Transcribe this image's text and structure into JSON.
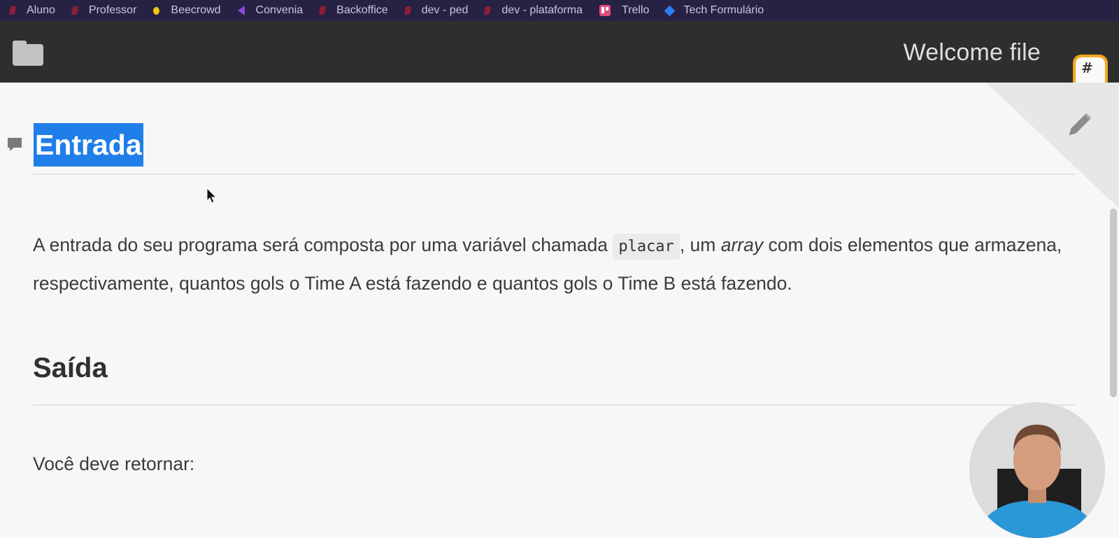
{
  "bookmarks": [
    {
      "label": "Aluno",
      "icon": "bookmark-icon"
    },
    {
      "label": "Professor",
      "icon": "bookmark-icon"
    },
    {
      "label": "Beecrowd",
      "icon": "beecrowd-icon"
    },
    {
      "label": "Convenia",
      "icon": "convenia-icon"
    },
    {
      "label": "Backoffice",
      "icon": "bookmark-icon"
    },
    {
      "label": "dev - ped",
      "icon": "bookmark-icon"
    },
    {
      "label": "dev - plataforma",
      "icon": "bookmark-icon"
    },
    {
      "label": "Trello",
      "icon": "trello-icon"
    },
    {
      "label": "Tech Formulário",
      "icon": "jira-icon"
    }
  ],
  "header": {
    "file_title": "Welcome file",
    "menu_icon": "folder-icon",
    "hash_button_text": "#"
  },
  "document": {
    "heading_entrada": "Entrada",
    "paragraph_entrada": {
      "before_code": "A entrada do seu programa será composta por uma variável chamada ",
      "code": "placar",
      "between": ", um ",
      "emphasis": "array",
      "after": " com dois elementos que armazena, respectivamente, quantos gols o Time A está fazendo e quantos gols o Time B está fazendo."
    },
    "heading_saida": "Saída",
    "paragraph_saida": "Você deve retornar:"
  },
  "colors": {
    "bookmarks_bar": "#272244",
    "appbar": "#2e2e2e",
    "selection": "#1f7ee8",
    "accent_orange": "#f4a81d"
  }
}
